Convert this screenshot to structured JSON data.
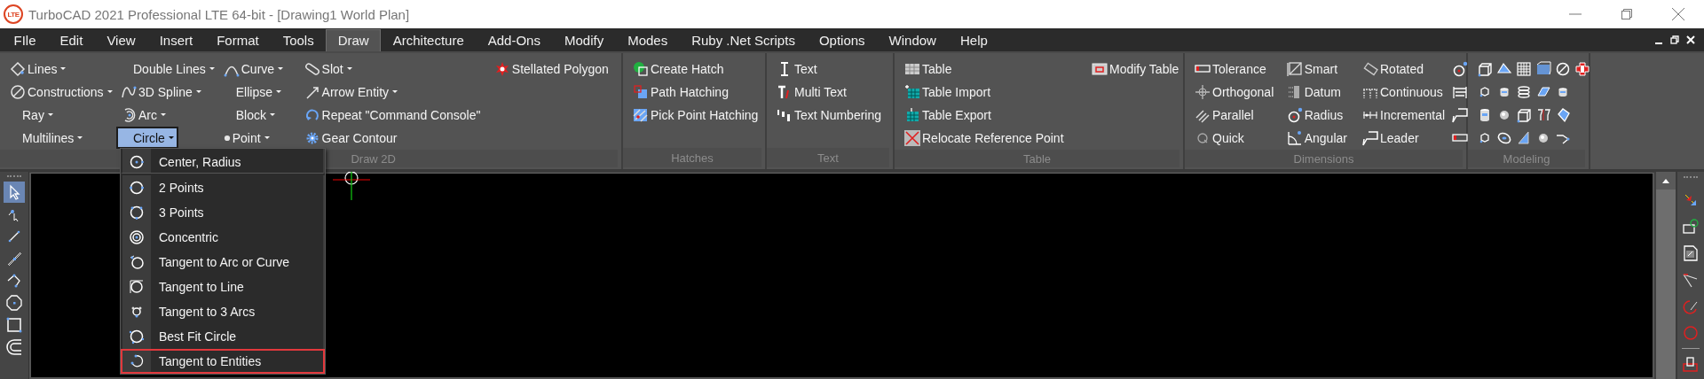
{
  "window": {
    "logo": "LTE",
    "title": "TurboCAD 2021 Professional LTE 64-bit - [Drawing1 World Plan]"
  },
  "menu": [
    {
      "label": "FIle",
      "selected": false
    },
    {
      "label": "Edit",
      "selected": false
    },
    {
      "label": "View",
      "selected": false
    },
    {
      "label": "Insert",
      "selected": false
    },
    {
      "label": "Format",
      "selected": false
    },
    {
      "label": "Tools",
      "selected": false
    },
    {
      "label": "Draw",
      "selected": true
    },
    {
      "label": "Architecture",
      "selected": false
    },
    {
      "label": "Add-Ons",
      "selected": false
    },
    {
      "label": "Modify",
      "selected": false
    },
    {
      "label": "Modes",
      "selected": false
    },
    {
      "label": "Ruby .Net Scripts",
      "selected": false
    },
    {
      "label": "Options",
      "selected": false
    },
    {
      "label": "Window",
      "selected": false
    },
    {
      "label": "Help",
      "selected": false
    }
  ],
  "ribbon": {
    "groups": [
      {
        "label": "Draw 2D",
        "columns": [
          [
            {
              "kind": "icon-label",
              "label": "Lines",
              "dropdown": true,
              "active": false
            },
            {
              "kind": "icon-label",
              "label": "Constructions",
              "dropdown": true,
              "active": false
            },
            {
              "kind": "label",
              "label": "Ray",
              "dropdown": true,
              "active": false
            },
            {
              "kind": "label",
              "label": "Multilines",
              "dropdown": true,
              "active": false
            }
          ],
          [
            {
              "kind": "label",
              "label": "Double Lines",
              "dropdown": true,
              "active": false
            },
            {
              "kind": "icon-label",
              "label": "3D Spline",
              "dropdown": true,
              "active": false
            },
            {
              "kind": "icon-label",
              "label": "Arc",
              "dropdown": true,
              "active": false
            },
            {
              "kind": "label",
              "label": "Circle",
              "dropdown": true,
              "active": true
            }
          ],
          [
            {
              "kind": "icon-label",
              "label": "Curve",
              "dropdown": true,
              "active": false
            },
            {
              "kind": "label",
              "label": "Ellipse",
              "dropdown": true,
              "active": false
            },
            {
              "kind": "label",
              "label": "Block",
              "dropdown": true,
              "active": false
            },
            {
              "kind": "icon-label",
              "label": "Point",
              "dropdown": true,
              "active": false
            }
          ],
          [
            {
              "kind": "icon-label",
              "label": "Slot",
              "dropdown": true,
              "active": false
            },
            {
              "kind": "icon-label",
              "label": "Arrow Entity",
              "dropdown": true,
              "active": false
            },
            {
              "kind": "icon-label",
              "label": "Repeat \"Command Console\"",
              "dropdown": false,
              "active": false
            },
            {
              "kind": "icon-label",
              "label": "Gear Contour",
              "dropdown": false,
              "active": false
            }
          ],
          [
            {
              "kind": "icon-label",
              "label": "Stellated Polygon",
              "dropdown": false,
              "active": false
            }
          ]
        ]
      },
      {
        "label": "Hatches",
        "columns": [
          [
            {
              "kind": "icon-label",
              "label": "Create Hatch",
              "dropdown": false,
              "active": false
            },
            {
              "kind": "icon-label",
              "label": "Path Hatching",
              "dropdown": false,
              "active": false
            },
            {
              "kind": "icon-label",
              "label": "Pick Point Hatching",
              "dropdown": false,
              "active": false
            }
          ]
        ]
      },
      {
        "label": "Text",
        "columns": [
          [
            {
              "kind": "icon-label",
              "label": "Text",
              "dropdown": false,
              "active": false
            },
            {
              "kind": "icon-label",
              "label": "Multi Text",
              "dropdown": false,
              "active": false
            },
            {
              "kind": "icon-label",
              "label": "Text Numbering",
              "dropdown": false,
              "active": false
            }
          ]
        ]
      },
      {
        "label": "Table",
        "columns": [
          [
            {
              "kind": "icon-label",
              "label": "Table",
              "dropdown": false,
              "active": false
            },
            {
              "kind": "icon-label",
              "label": "Table Import",
              "dropdown": false,
              "active": false
            },
            {
              "kind": "icon-label",
              "label": "Table Export",
              "dropdown": false,
              "active": false
            },
            {
              "kind": "icon-label",
              "label": "Relocate Reference Point",
              "dropdown": false,
              "active": false
            }
          ],
          [
            {
              "kind": "icon-label",
              "label": "Modify Table",
              "dropdown": false,
              "active": false
            }
          ]
        ]
      },
      {
        "label": "Dimensions",
        "columns": [
          [
            {
              "kind": "icon-label",
              "label": "Tolerance",
              "dropdown": false,
              "active": false
            },
            {
              "kind": "icon-label",
              "label": "Orthogonal",
              "dropdown": false,
              "active": false
            },
            {
              "kind": "icon-label",
              "label": "Parallel",
              "dropdown": false,
              "active": false
            },
            {
              "kind": "icon-label",
              "label": "Quick",
              "dropdown": false,
              "active": false
            }
          ],
          [
            {
              "kind": "icon-label",
              "label": "Smart",
              "dropdown": false,
              "active": false
            },
            {
              "kind": "icon-label",
              "label": "Datum",
              "dropdown": false,
              "active": false
            },
            {
              "kind": "icon-label",
              "label": "Radius",
              "dropdown": false,
              "active": false
            },
            {
              "kind": "icon-label",
              "label": "Angular",
              "dropdown": false,
              "active": false
            }
          ],
          [
            {
              "kind": "icon-label",
              "label": "Rotated",
              "dropdown": false,
              "active": false
            },
            {
              "kind": "icon-label",
              "label": "Continuous",
              "dropdown": false,
              "active": false
            },
            {
              "kind": "icon-label",
              "label": "Incremental",
              "dropdown": false,
              "active": false
            },
            {
              "kind": "icon-label",
              "label": "Leader",
              "dropdown": false,
              "active": false
            }
          ],
          [
            {
              "kind": "icon",
              "active": false
            },
            {
              "kind": "icon",
              "active": false
            },
            {
              "kind": "icon",
              "active": false
            },
            {
              "kind": "icon",
              "active": false
            }
          ]
        ]
      },
      {
        "label": "Modeling",
        "columns": [
          [
            {
              "kind": "icon",
              "active": false
            },
            {
              "kind": "icon",
              "active": false
            },
            {
              "kind": "icon",
              "active": false
            },
            {
              "kind": "icon",
              "active": false
            }
          ],
          [
            {
              "kind": "icon",
              "active": false
            },
            {
              "kind": "icon",
              "active": false
            },
            {
              "kind": "icon",
              "active": false
            },
            {
              "kind": "icon",
              "active": false
            }
          ],
          [
            {
              "kind": "icon",
              "active": false
            },
            {
              "kind": "icon",
              "active": false
            },
            {
              "kind": "icon",
              "active": false
            },
            {
              "kind": "icon",
              "active": false
            }
          ],
          [
            {
              "kind": "icon",
              "active": false
            },
            {
              "kind": "icon",
              "active": false
            },
            {
              "kind": "icon",
              "active": false
            },
            {
              "kind": "icon",
              "active": false
            }
          ],
          [
            {
              "kind": "icon",
              "active": false
            },
            {
              "kind": "icon",
              "active": false
            },
            {
              "kind": "icon",
              "active": false
            },
            {
              "kind": "icon",
              "active": false
            }
          ],
          [
            {
              "kind": "icon",
              "active": false
            }
          ]
        ]
      }
    ]
  },
  "left_toolbar": {
    "tools": [
      {
        "selected": true
      },
      {
        "selected": false
      },
      {
        "selected": false
      },
      {
        "selected": false
      },
      {
        "selected": false
      },
      {
        "selected": false
      },
      {
        "selected": false
      },
      {
        "selected": false
      }
    ]
  },
  "circle_menu": {
    "items": [
      {
        "label": "Center, Radius",
        "outlined": false
      },
      {
        "label": "2 Points",
        "outlined": false
      },
      {
        "label": "3 Points",
        "outlined": false
      },
      {
        "label": "Concentric",
        "outlined": false
      },
      {
        "label": "Tangent to Arc or Curve",
        "outlined": false
      },
      {
        "label": "Tangent to Line",
        "outlined": false
      },
      {
        "label": "Tangent to 3 Arcs",
        "outlined": false
      },
      {
        "label": "Best Fit Circle",
        "outlined": false
      },
      {
        "label": "Tangent to Entities",
        "outlined": true
      }
    ]
  }
}
